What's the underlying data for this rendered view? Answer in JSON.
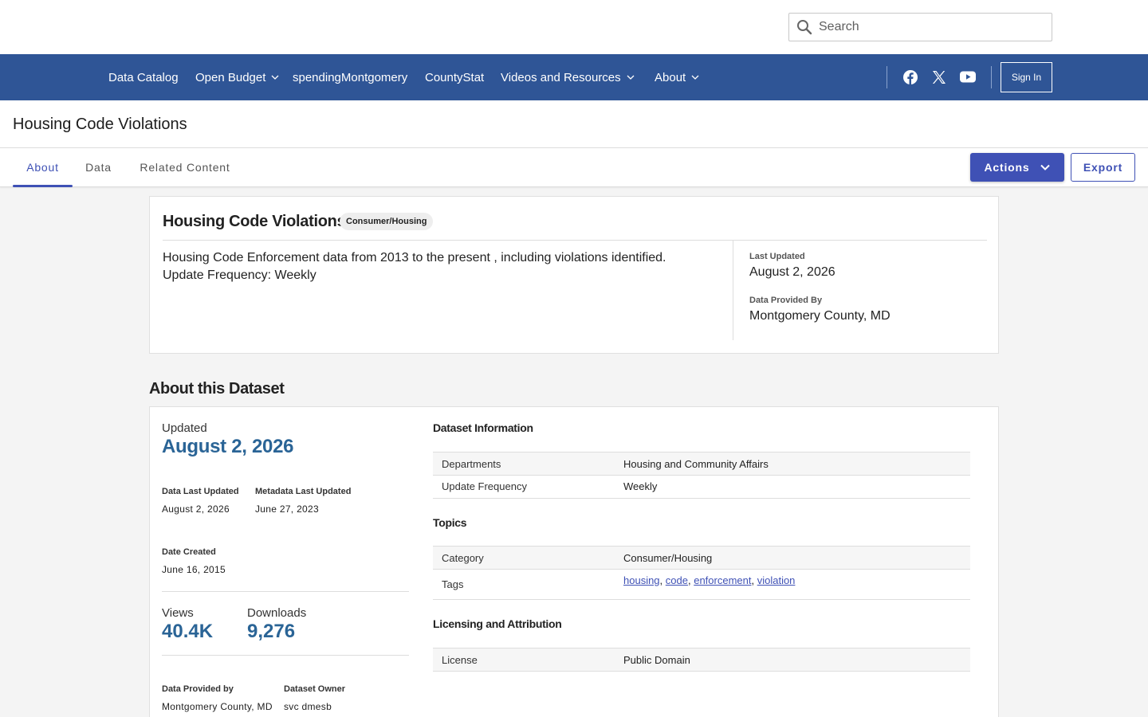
{
  "search": {
    "placeholder": "Search"
  },
  "nav": {
    "items": [
      {
        "label": "Data Catalog"
      },
      {
        "label": "Open Budget"
      },
      {
        "label": "spendingMontgomery"
      },
      {
        "label": "CountyStat"
      },
      {
        "label": "Videos and Resources"
      },
      {
        "label": "About"
      }
    ],
    "sign_in": "Sign In"
  },
  "page": {
    "title": "Housing Code Violations"
  },
  "tabs": [
    {
      "label": "About"
    },
    {
      "label": "Data"
    },
    {
      "label": "Related Content"
    }
  ],
  "toolbar": {
    "actions_label": "Actions",
    "export_label": "Export"
  },
  "summary": {
    "title": "Housing Code Violations",
    "category_badge": "Consumer/Housing",
    "description_line1": "Housing Code Enforcement data from 2013 to the present , including violations identified.",
    "description_line2": "Update Frequency: Weekly",
    "last_updated_label": "Last Updated",
    "last_updated_value": "August 2, 2026",
    "provided_by_label": "Data Provided By",
    "provided_by_value": "Montgomery County, MD"
  },
  "about": {
    "section_title": "About this Dataset",
    "updated_label": "Updated",
    "updated_value": "August 2, 2026",
    "data_last_updated_label": "Data Last Updated",
    "data_last_updated_value": "August 2, 2026",
    "metadata_last_updated_label": "Metadata Last Updated",
    "metadata_last_updated_value": "June 27, 2023",
    "date_created_label": "Date Created",
    "date_created_value": "June 16, 2015",
    "views_label": "Views",
    "views_value": "40.4K",
    "downloads_label": "Downloads",
    "downloads_value": "9,276",
    "provided_by_label": "Data Provided by",
    "provided_by_value": "Montgomery County, MD",
    "owner_label": "Dataset Owner",
    "owner_value": "svc dmesb"
  },
  "dataset_info": {
    "heading": "Dataset Information",
    "rows": [
      {
        "key": "Departments",
        "value": "Housing and Community Affairs"
      },
      {
        "key": "Update Frequency",
        "value": "Weekly"
      }
    ]
  },
  "topics": {
    "heading": "Topics",
    "category_key": "Category",
    "category_value": "Consumer/Housing",
    "tags_key": "Tags",
    "tags": [
      "housing",
      "code",
      "enforcement",
      "violation"
    ]
  },
  "licensing": {
    "heading": "Licensing and Attribution",
    "license_key": "License",
    "license_value": "Public Domain"
  },
  "colors": {
    "nav_bg": "#2f5596",
    "accent": "#3f51b5",
    "stat_blue": "#2a6496"
  }
}
